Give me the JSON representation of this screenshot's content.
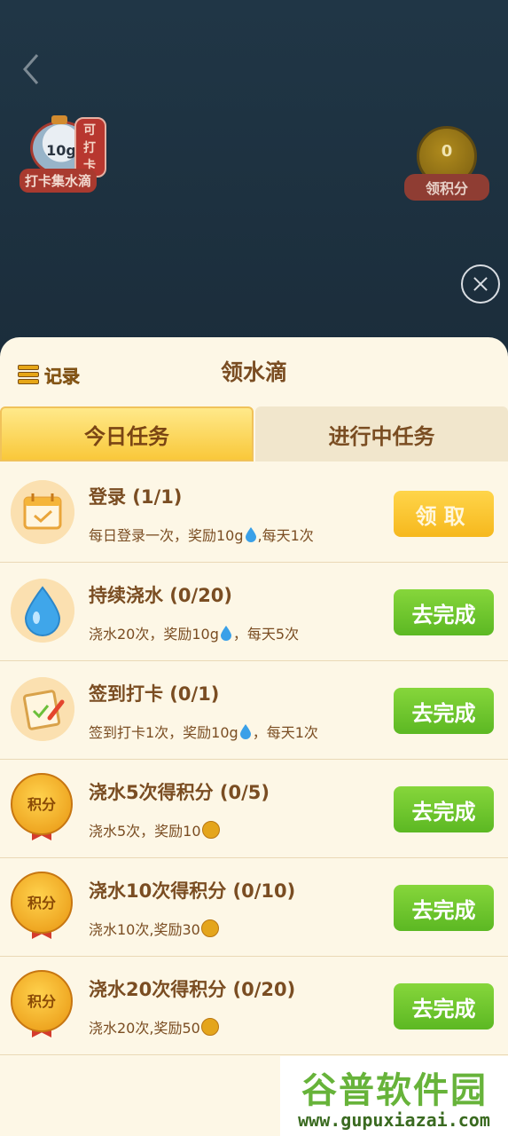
{
  "top": {
    "checkin_amount": "10g",
    "checkin_tag": "可打卡",
    "checkin_label": "打卡集水滴",
    "points_value": "0",
    "points_label": "领积分"
  },
  "sheet": {
    "record_label": "记录",
    "title": "领水滴",
    "tabs": [
      {
        "label": "今日任务"
      },
      {
        "label": "进行中任务"
      }
    ]
  },
  "tasks": [
    {
      "title": "登录 (1/1)",
      "desc_pre": "每日登录一次，奖励10g",
      "desc_post": ",每天1次",
      "button": "领取",
      "icon": "calendar-icon",
      "reward_icon": "water-drop-icon"
    },
    {
      "title": "持续浇水 (0/20)",
      "desc_pre": "浇水20次，奖励10g",
      "desc_post": "，每天5次",
      "button": "去完成",
      "icon": "water-drop-icon",
      "reward_icon": "water-drop-icon"
    },
    {
      "title": "签到打卡 (0/1)",
      "desc_pre": "签到打卡1次，奖励10g",
      "desc_post": "，每天1次",
      "button": "去完成",
      "icon": "checkin-note-icon",
      "reward_icon": "water-drop-icon"
    },
    {
      "title": "浇水5次得积分 (0/5)",
      "desc_pre": "浇水5次，奖励10",
      "desc_post": "",
      "button": "去完成",
      "icon": "points-medal-icon",
      "reward_icon": "points-coin-icon",
      "medal_text": "积分"
    },
    {
      "title": "浇水10次得积分 (0/10)",
      "desc_pre": "浇水10次,奖励30",
      "desc_post": "",
      "button": "去完成",
      "icon": "points-medal-icon",
      "reward_icon": "points-coin-icon",
      "medal_text": "积分"
    },
    {
      "title": "浇水20次得积分 (0/20)",
      "desc_pre": "浇水20次,奖励50",
      "desc_post": "",
      "button": "去完成",
      "icon": "points-medal-icon",
      "reward_icon": "points-coin-icon",
      "medal_text": "积分"
    }
  ],
  "watermark": {
    "name": "谷普软件园",
    "url": "www.gupuxiazai.com"
  },
  "colors": {
    "claim_button": "#f9c22b",
    "go_button": "#6cc52a",
    "sheet_bg": "#fdf7e6",
    "text_brown": "#7a4d22"
  }
}
